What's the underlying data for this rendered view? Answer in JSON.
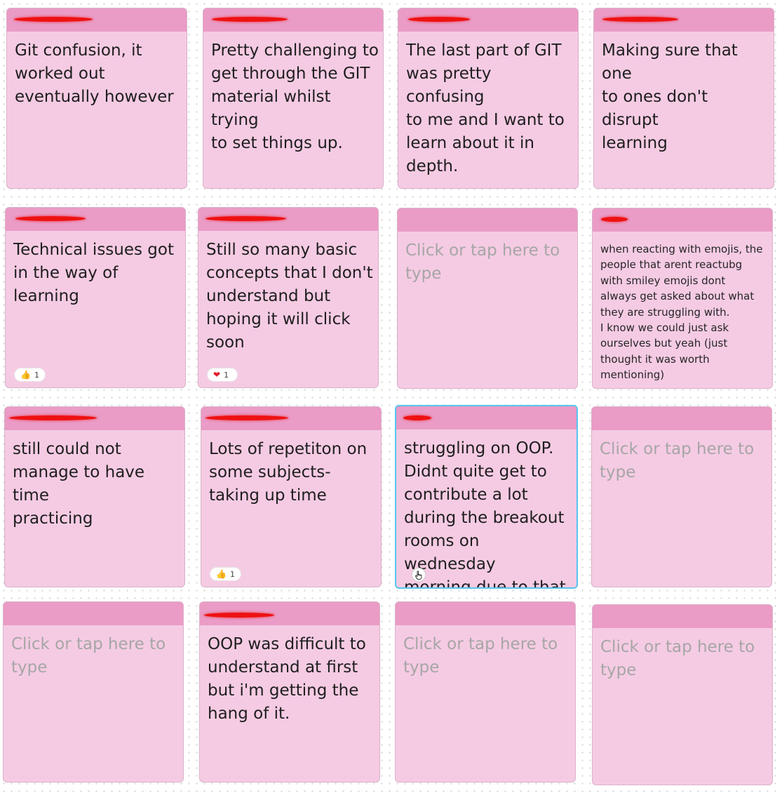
{
  "board": {
    "notes": [
      {
        "text": "Git confusion, it\nworked out\neventually however",
        "style": "normal",
        "redaction": "author-name-redacted",
        "reaction": null
      },
      {
        "text": "Pretty challenging to\nget through the GIT\nmaterial whilst trying\nto set things up.",
        "style": "normal",
        "redaction": "author-name-redacted",
        "reaction": null
      },
      {
        "text": "The last part of GIT\nwas pretty confusing\nto me and I want to\nlearn about it in\ndepth.",
        "style": "normal",
        "redaction": "author-name-redacted",
        "reaction": null
      },
      {
        "text": "Making sure that one\nto ones don't disrupt\nlearning",
        "style": "normal",
        "redaction": "author-name-redacted",
        "reaction": null
      },
      {
        "text": "Technical issues got\nin the way of learning",
        "style": "normal",
        "redaction": "author-name-redacted",
        "reaction": {
          "emoji": "thumbs-up-emoji",
          "glyph": "👍",
          "count": "1"
        }
      },
      {
        "text": "Still so many basic\nconcepts that I don't\nunderstand but\nhoping it will click\nsoon",
        "style": "normal",
        "redaction": "author-name-redacted",
        "reaction": {
          "emoji": "heart-emoji",
          "glyph": "❤",
          "count": "1"
        }
      },
      {
        "text": "Click or tap here to\ntype",
        "style": "placeholder",
        "redaction": null,
        "reaction": null
      },
      {
        "text": "when reacting with emojis, the\npeople that arent reactubg\nwith smiley emojis dont\nalways get asked about what\nthey are struggling with.\nI know we could just ask\nourselves but yeah (just\nthought it was worth\nmentioning)",
        "style": "small",
        "redaction": "author-name-redacted",
        "reaction": null
      },
      {
        "text": "still could not\nmanage to have time\npracticing",
        "style": "normal",
        "redaction": "author-name-redacted",
        "reaction": null
      },
      {
        "text": "Lots of repetiton on\nsome subjects-\ntaking up time",
        "style": "normal",
        "redaction": "author-name-redacted",
        "reaction": {
          "emoji": "thumbs-up-emoji",
          "glyph": "👍",
          "count": "1"
        }
      },
      {
        "text": "struggling on OOP.\nDidnt quite get to\ncontribute a lot\nduring the breakout\nrooms on wednesday\nmorning due to that.",
        "style": "normal",
        "redaction": "author-name-redacted",
        "reaction": null,
        "selected": true,
        "add_reaction_icon": "add-reaction-icon"
      },
      {
        "text": "Click or tap here to\ntype",
        "style": "placeholder",
        "redaction": null,
        "reaction": null
      },
      {
        "text": "Click or tap here to\ntype",
        "style": "placeholder",
        "redaction": null,
        "reaction": null
      },
      {
        "text": "OOP was difficult to\nunderstand at first\nbut i'm getting the\nhang of it.",
        "style": "normal",
        "redaction": "author-name-redacted",
        "reaction": null
      },
      {
        "text": "Click or tap here to\ntype",
        "style": "placeholder",
        "redaction": null,
        "reaction": null
      },
      {
        "text": "Click or tap here to\ntype",
        "style": "placeholder",
        "redaction": null,
        "reaction": null
      }
    ]
  },
  "colors": {
    "note_body": "#f5cbe3",
    "note_header": "#ea9bc6",
    "selection_border": "#55c6ee",
    "redaction": "#ee1111",
    "placeholder_text": "#a6a6a6"
  }
}
